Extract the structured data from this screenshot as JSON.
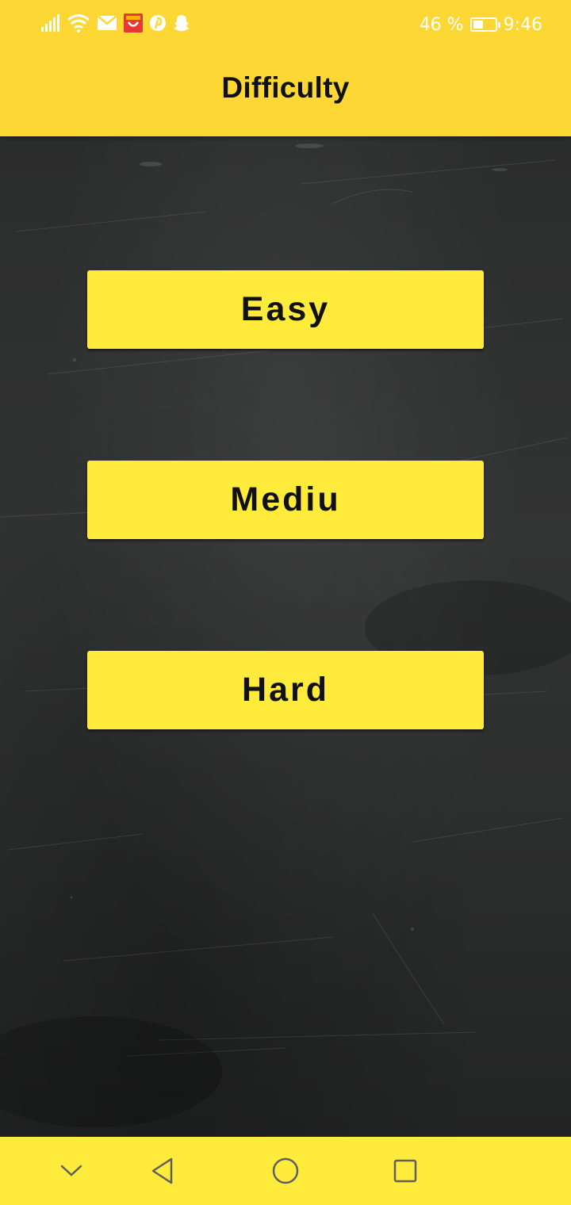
{
  "status_bar": {
    "battery_text": "46 %",
    "time": "9:46",
    "battery_level": 0.46,
    "icons": [
      "signal-icon",
      "wifi-icon",
      "mail-icon",
      "shopping-app-icon",
      "pinterest-icon",
      "snapchat-icon",
      "battery-icon"
    ]
  },
  "app_bar": {
    "title": "Difficulty"
  },
  "difficulty": {
    "easy_label": "Easy",
    "medium_label": "Mediu",
    "hard_label": "Hard"
  },
  "nav_bar": {
    "icons": [
      "hide-keyboard-icon",
      "back-icon",
      "home-icon",
      "recent-apps-icon"
    ]
  },
  "colors": {
    "header": "#fdd835",
    "button": "#ffeb3b",
    "navbar": "#ffeb3b",
    "board": "#2b2c2c",
    "text": "#111111"
  }
}
